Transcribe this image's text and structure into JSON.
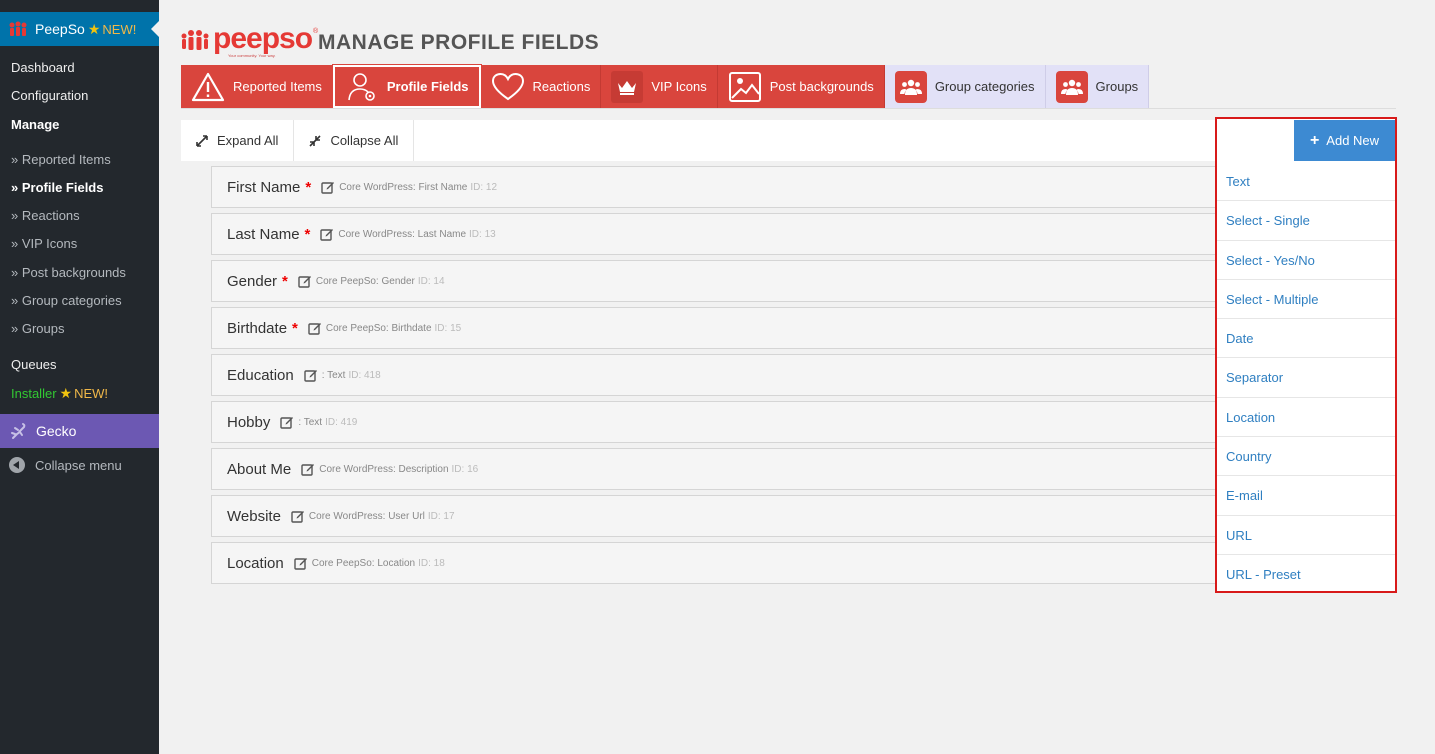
{
  "sidebar": {
    "plugin_name": "PeepSo",
    "new_badge": "NEW!",
    "items": [
      {
        "label": "Dashboard"
      },
      {
        "label": "Configuration"
      },
      {
        "label": "Manage"
      },
      {
        "label": "» Reported Items"
      },
      {
        "label": "» Profile Fields"
      },
      {
        "label": "» Reactions"
      },
      {
        "label": "» VIP Icons"
      },
      {
        "label": "» Post backgrounds"
      },
      {
        "label": "» Group categories"
      },
      {
        "label": "» Groups"
      },
      {
        "label": "Queues"
      },
      {
        "label": "Installer"
      }
    ],
    "installer_new": "NEW!",
    "gecko": "Gecko",
    "collapse": "Collapse menu"
  },
  "header": {
    "logo_text": "peepso",
    "logo_tagline": "Your community. Your way.",
    "title": "MANAGE PROFILE FIELDS"
  },
  "tabs": [
    {
      "label": "Reported Items"
    },
    {
      "label": "Profile Fields"
    },
    {
      "label": "Reactions"
    },
    {
      "label": "VIP Icons"
    },
    {
      "label": "Post backgrounds"
    },
    {
      "label": "Group categories"
    },
    {
      "label": "Groups"
    }
  ],
  "toolbar": {
    "expand": "Expand All",
    "collapse": "Collapse All",
    "add_new": "Add New"
  },
  "fields": [
    {
      "name": "First Name",
      "required": "*",
      "meta": "Core WordPress: First Name",
      "id": "ID: 12"
    },
    {
      "name": "Last Name",
      "required": "*",
      "meta": "Core WordPress: Last Name",
      "id": "ID: 13"
    },
    {
      "name": "Gender",
      "required": "*",
      "meta": "Core PeepSo: Gender",
      "id": "ID: 14"
    },
    {
      "name": "Birthdate",
      "required": "*",
      "meta": "Core PeepSo: Birthdate",
      "id": "ID: 15"
    },
    {
      "name": "Education",
      "required": "",
      "meta": ": Text",
      "id": "ID: 418"
    },
    {
      "name": "Hobby",
      "required": "",
      "meta": ": Text",
      "id": "ID: 419"
    },
    {
      "name": "About Me",
      "required": "",
      "meta": "Core WordPress: Description",
      "id": "ID: 16"
    },
    {
      "name": "Website",
      "required": "",
      "meta": "Core WordPress: User Url",
      "id": "ID: 17"
    },
    {
      "name": "Location",
      "required": "",
      "meta": "Core PeepSo: Location",
      "id": "ID: 18"
    }
  ],
  "add_options": [
    {
      "label": "Text"
    },
    {
      "label": "Select - Single"
    },
    {
      "label": "Select - Yes/No"
    },
    {
      "label": "Select - Multiple"
    },
    {
      "label": "Date"
    },
    {
      "label": "Separator"
    },
    {
      "label": "Location"
    },
    {
      "label": "Country"
    },
    {
      "label": "E-mail"
    },
    {
      "label": "URL"
    },
    {
      "label": "URL - Preset"
    }
  ],
  "colors": {
    "accent_red": "#d9453d",
    "wp_blue": "#0073aa",
    "link_blue": "#2f7fc1",
    "highlight_border": "#d81a1a"
  }
}
